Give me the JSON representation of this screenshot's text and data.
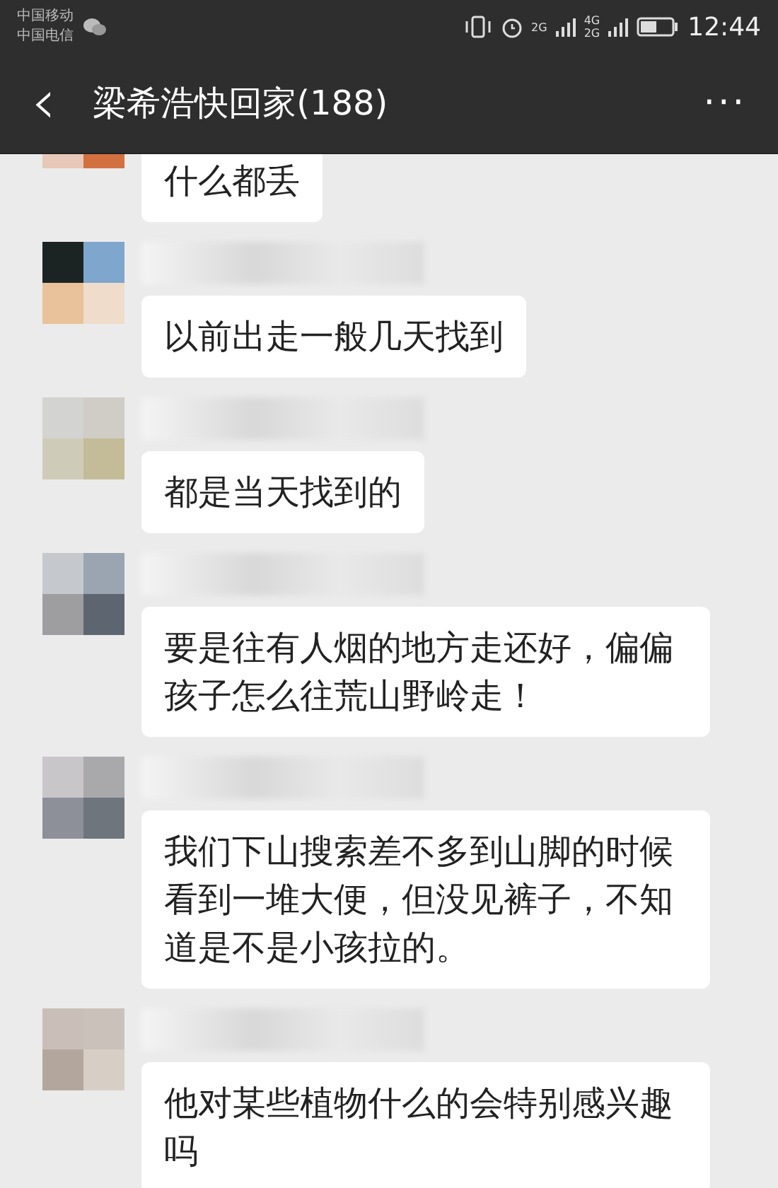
{
  "status_bar": {
    "carriers": [
      "中国移动",
      "中国电信"
    ],
    "network_1": "2G",
    "network_2a": "4G",
    "network_2b": "2G",
    "time": "12:44"
  },
  "header": {
    "back": "‹",
    "title": "梁希浩快回家(188)",
    "more": "···"
  },
  "messages": [
    {
      "kind": "continued",
      "text": "什么都丢"
    },
    {
      "kind": "picture",
      "text": "以前出走一般几天找到"
    },
    {
      "kind": "picture",
      "text": "都是当天找到的"
    },
    {
      "kind": "picture",
      "text": "要是往有人烟的地方走还好，偏偏孩子怎么往荒山野岭走！"
    },
    {
      "kind": "picture",
      "text": "我们下山搜索差不多到山脚的时候看到一堆大便，但没见裤子，不知道是不是小孩拉的。"
    },
    {
      "kind": "picture",
      "text": "他对某些植物什么的会特别感兴趣吗"
    }
  ]
}
